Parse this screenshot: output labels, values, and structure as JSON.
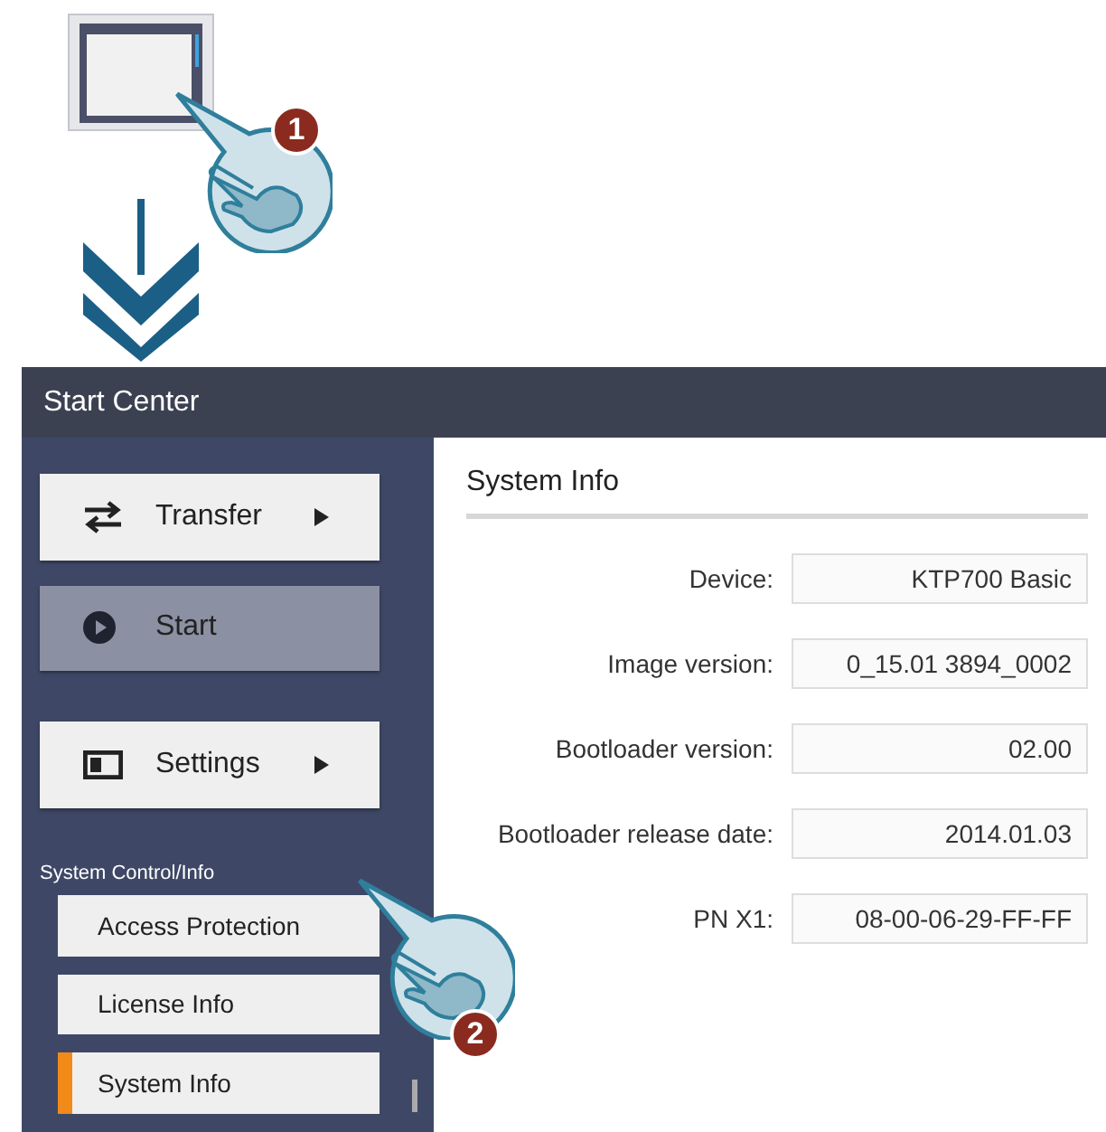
{
  "illustration": {
    "step_badges": [
      "1",
      "2"
    ]
  },
  "window": {
    "title": "Start Center"
  },
  "sidebar": {
    "buttons": [
      {
        "kind": "transfer",
        "label": "Transfer",
        "submenu": true,
        "selected": false
      },
      {
        "kind": "start",
        "label": "Start",
        "submenu": false,
        "selected": true
      },
      {
        "kind": "settings",
        "label": "Settings",
        "submenu": true,
        "selected": false
      }
    ],
    "section_label": "System Control/Info",
    "items": [
      {
        "label": "Access Protection",
        "selected": false
      },
      {
        "label": "License Info",
        "selected": false
      },
      {
        "label": "System Info",
        "selected": true
      }
    ]
  },
  "panel": {
    "title": "System Info",
    "fields": [
      {
        "label": "Device:",
        "value": "KTP700 Basic"
      },
      {
        "label": "Image version:",
        "value": "0_15.01 3894_0002"
      },
      {
        "label": "Bootloader version:",
        "value": "02.00"
      },
      {
        "label": "Bootloader release date:",
        "value": "2014.01.03"
      },
      {
        "label": "PN X1:",
        "value": "08-00-06-29-FF-FF"
      }
    ]
  }
}
